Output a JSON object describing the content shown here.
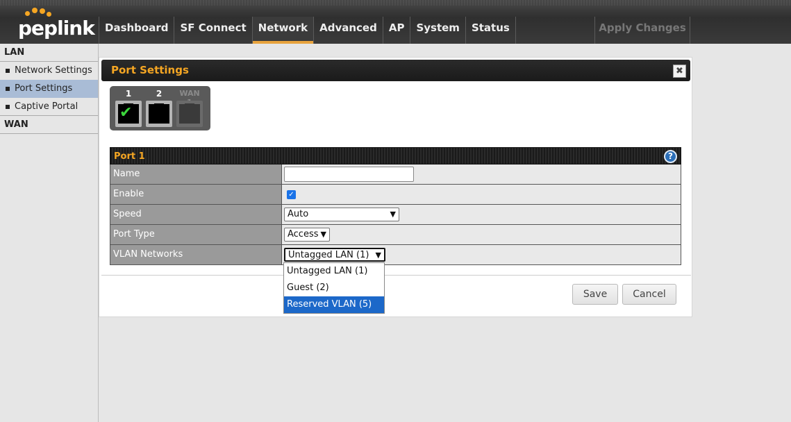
{
  "header": {
    "logo_text": "peplink",
    "nav": [
      {
        "label": "Dashboard"
      },
      {
        "label": "SF Connect"
      },
      {
        "label": "Network"
      },
      {
        "label": "Advanced"
      },
      {
        "label": "AP"
      },
      {
        "label": "System"
      },
      {
        "label": "Status"
      }
    ],
    "active_nav": "Network",
    "apply_label": "Apply Changes"
  },
  "sidebar": {
    "groups": [
      {
        "title": "LAN",
        "items": [
          "Network Settings",
          "Port Settings",
          "Captive Portal"
        ]
      },
      {
        "title": "WAN",
        "items": []
      }
    ],
    "active_item": "Port Settings"
  },
  "panel": {
    "title": "Port Settings",
    "close_symbol": "✖",
    "ports": [
      {
        "label": "1",
        "selected": true,
        "enabled": true
      },
      {
        "label": "2",
        "selected": false,
        "enabled": true
      },
      {
        "label": "WAN 1",
        "selected": false,
        "enabled": false
      }
    ],
    "table": {
      "title": "Port 1",
      "help_symbol": "?",
      "rows": {
        "name": {
          "label": "Name",
          "value": ""
        },
        "enable": {
          "label": "Enable",
          "checked": true
        },
        "speed": {
          "label": "Speed",
          "value": "Auto"
        },
        "port_type": {
          "label": "Port Type",
          "value": "Access"
        },
        "vlan": {
          "label": "VLAN Networks",
          "value": "Untagged LAN (1)"
        }
      }
    },
    "vlan_options": [
      "Untagged LAN (1)",
      "Guest (2)",
      "Reserved VLAN (5)"
    ],
    "highlighted_option": "Reserved VLAN (5)",
    "save_label": "Save",
    "cancel_label": "Cancel"
  },
  "colors": {
    "accent": "#f5a623",
    "sidebar_active": "#a9bcd6",
    "option_highlight": "#1c68c9"
  }
}
